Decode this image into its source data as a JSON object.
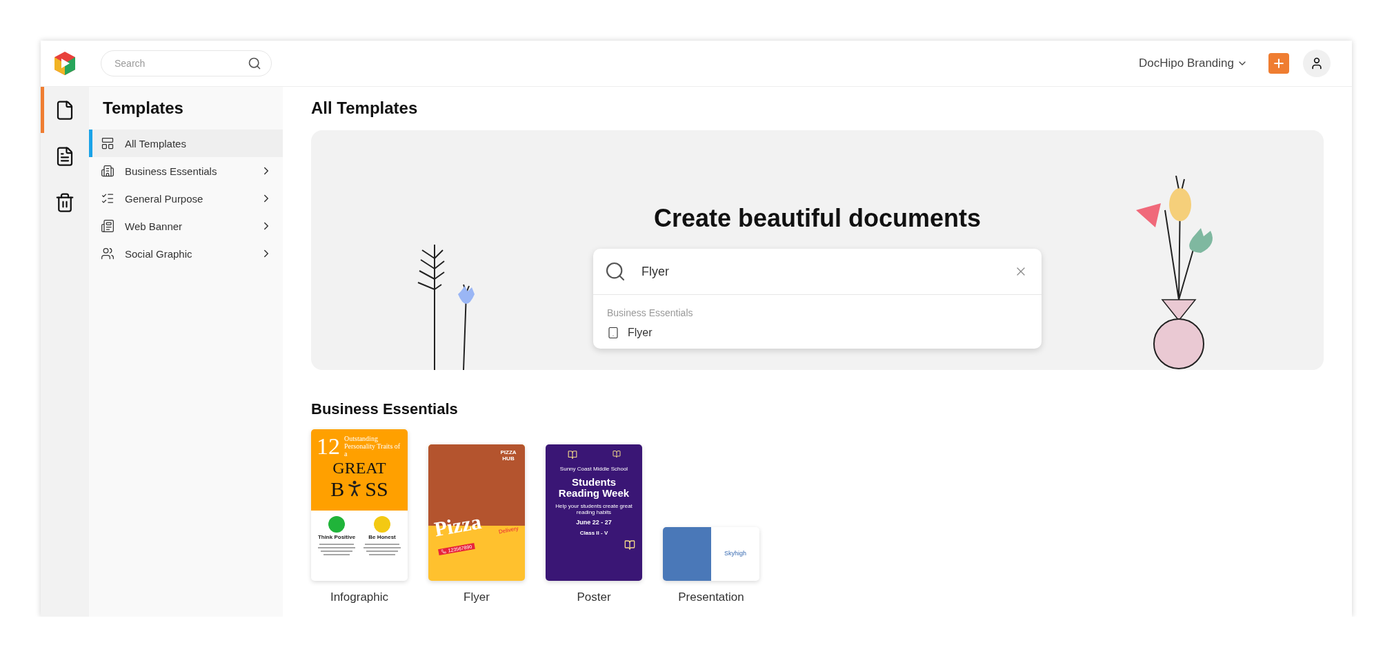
{
  "header": {
    "search": {
      "placeholder": "Search"
    },
    "workspace": "DocHipo Branding"
  },
  "rail": [
    {
      "kind": "document",
      "selected": true
    },
    {
      "kind": "text-document",
      "selected": false
    },
    {
      "kind": "trash",
      "selected": false
    }
  ],
  "sidebar": {
    "title": "Templates",
    "items": [
      {
        "label": "All Templates",
        "selected": true,
        "expandable": false
      },
      {
        "label": "Business Essentials",
        "selected": false,
        "expandable": true
      },
      {
        "label": "General Purpose",
        "selected": false,
        "expandable": true
      },
      {
        "label": "Web Banner",
        "selected": false,
        "expandable": true
      },
      {
        "label": "Social Graphic",
        "selected": false,
        "expandable": true
      }
    ]
  },
  "main": {
    "title": "All Templates",
    "hero": {
      "title": "Create beautiful documents",
      "search": {
        "value": "Flyer"
      },
      "suggestions": {
        "group": "Business Essentials",
        "items": [
          "Flyer"
        ]
      }
    },
    "section": {
      "title": "Business Essentials",
      "templates": [
        {
          "label": "Infographic",
          "kind": "infographic",
          "texts": [
            "12",
            "Outstanding Personality Traits of a",
            "GREAT",
            "B",
            "SS",
            "Think Positive",
            "Be Honest"
          ]
        },
        {
          "label": "Flyer",
          "kind": "flyer",
          "texts": [
            "PIZZA HUB",
            "Pizza",
            "Delivery",
            "123567890"
          ]
        },
        {
          "label": "Poster",
          "kind": "poster",
          "texts": [
            "Sunny Coast Middle School",
            "Students Reading Week",
            "Help your students create great reading habits",
            "June 22 - 27",
            "Class II - V"
          ]
        },
        {
          "label": "Presentation",
          "kind": "presentation",
          "texts": [
            "Skyhigh"
          ]
        }
      ]
    }
  }
}
